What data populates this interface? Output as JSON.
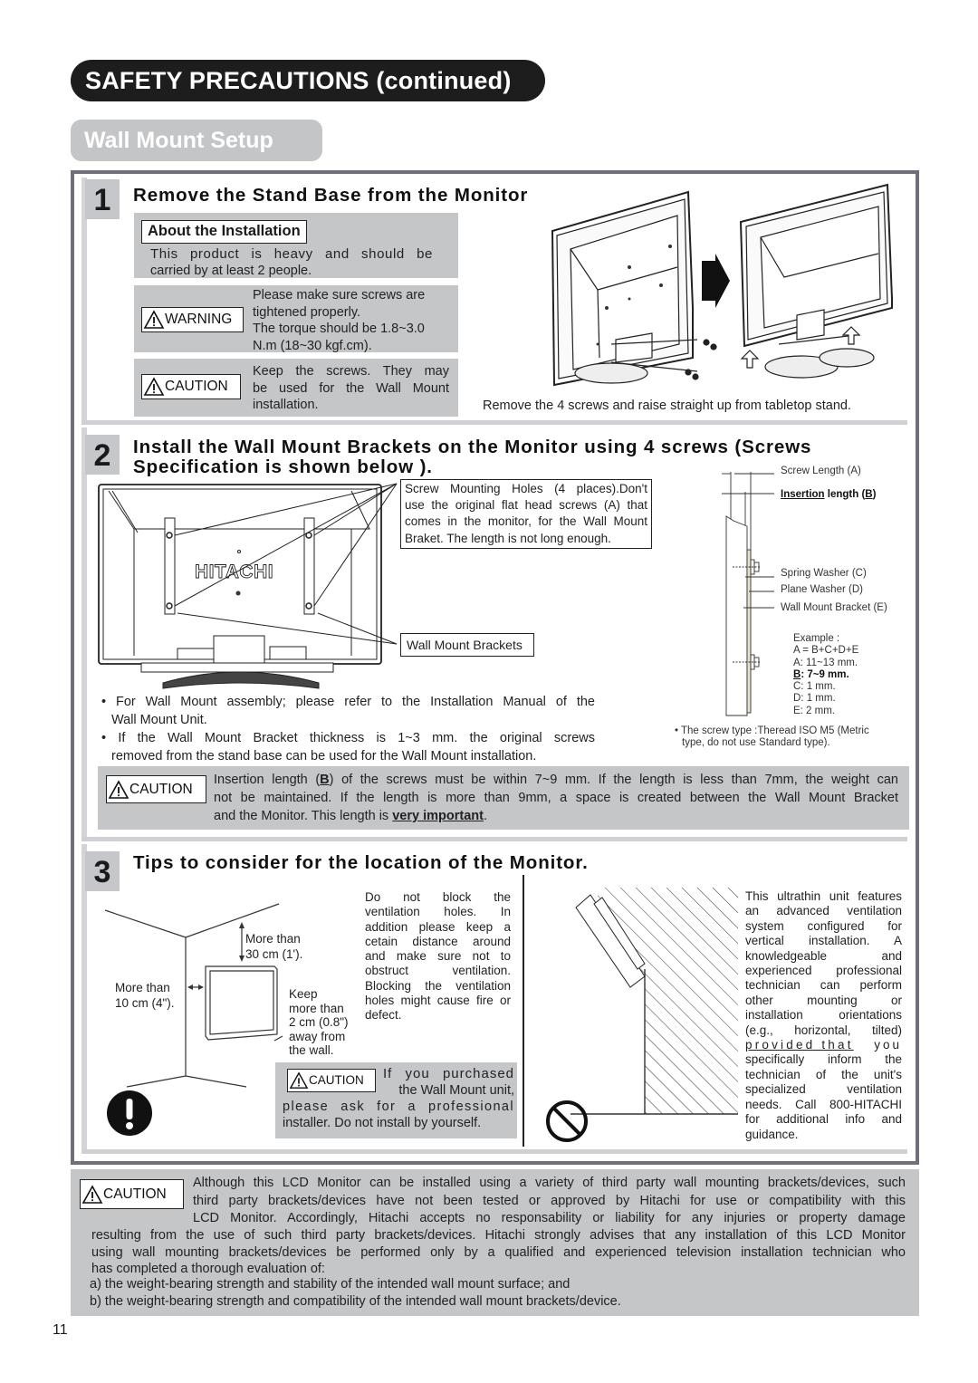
{
  "header": {
    "title": "SAFETY PRECAUTIONS (continued)",
    "subtitle": "Wall Mount Setup"
  },
  "step1": {
    "number": "1",
    "title": "Remove the Stand Base from the Monitor",
    "about_label": "About the Installation",
    "about_text_line1": "This product is heavy and should be",
    "about_text_line2": "carried by at least 2 people.",
    "warning_label": "WARNING",
    "warning_lines": [
      "Please make sure screws are",
      "tightened properly.",
      "The torque should be 1.8~3.0",
      "N.m (18~30 kgf.cm)."
    ],
    "caution_label": "CAUTION",
    "caution_lines": [
      "Keep the screws. They may",
      "be used for the Wall Mount",
      "installation."
    ],
    "figure_caption": "Remove the 4 screws and raise straight up from tabletop stand."
  },
  "step2": {
    "number": "2",
    "title_line1": "Install the Wall Mount Brackets on the Monitor using 4 screws (Screws",
    "title_line2": "Specification is shown below ).",
    "callout_holes_lines": [
      "Screw Mounting Holes (4 places).Don't",
      "use the original flat head screws (A) that",
      "comes in the monitor, for the Wall Mount",
      "Braket. The length is not long enough."
    ],
    "callout_brackets": "Wall Mount Brackets",
    "brand_logo": "HITACHI",
    "bullets": [
      {
        "line1": "For Wall Mount assembly; please refer to the Installation Manual of the",
        "line2": "Wall Mount Unit."
      },
      {
        "line1": "If the Wall Mount Bracket thickness is 1~3 mm. the original screws",
        "line2": "removed from the stand base can be used for the Wall Mount installation."
      }
    ],
    "diagram": {
      "screw_length": "Screw Length (A)",
      "insertion_prefix": "Insertion",
      "insertion_mid": " length (",
      "insertion_b": "B",
      "insertion_end": ")",
      "spring_washer": "Spring Washer (C)",
      "plane_washer": "Plane Washer (D)",
      "bracket": "Wall Mount Bracket (E)",
      "example_lines": [
        "Example :",
        "A = B+C+D+E",
        "A: 11~13 mm."
      ],
      "example_b_letter": "B",
      "example_b_rest": ": 7~9 mm.",
      "example_lines2": [
        "C: 1 mm.",
        "D: 1 mm.",
        "E: 2 mm."
      ],
      "screw_type_line1": "The screw type :Theread ISO M5 (Metric",
      "screw_type_line2": "type, do not use Standard type)."
    },
    "caution_label": "CAUTION",
    "caution_line1_a": "Insertion length (",
    "caution_line1_b": "B",
    "caution_line1_c": ") of the screws must be within 7~9 mm. If the length is less than 7mm, the weight can",
    "caution_line2": "not be maintained. If the length is more than 9mm, a space is created between the Wall Mount Bracket",
    "caution_line3_a": "and the Monitor. This length is ",
    "caution_line3_b": "very important",
    "caution_line3_c": "."
  },
  "step3": {
    "number": "3",
    "title": "Tips to consider for the location of the Monitor.",
    "label_top_1": "More than",
    "label_top_2": "30 cm (1').",
    "label_left_1": "More than",
    "label_left_2": "10 cm (4\").",
    "label_wall_lines": [
      "Keep",
      "more than",
      "2 cm (0.8\")",
      "away from",
      "the wall."
    ],
    "ventilation_lines": [
      "Do not block the",
      "ventilation holes. In",
      "addition please keep a",
      "cetain distance around",
      "and make sure not to",
      "obstruct ventilation.",
      "Blocking the ventilation",
      "holes might cause fire or",
      "defect."
    ],
    "caution_label": "CAUTION",
    "caution_lines": [
      "If you purchased",
      "the Wall Mount unit,",
      "please ask for a professional",
      "installer. Do not install by yourself."
    ],
    "ultrathin_lines": [
      "This ultrathin unit features",
      "an advanced ventilation",
      "system configured for",
      "vertical installation. A",
      "knowledgeable and",
      "experienced professional",
      "technician can perform",
      "other mounting or",
      "installation orientations",
      "(e.g., horizontal, tilted)"
    ],
    "provided_that": "provided that",
    "provided_rest": " you",
    "ultrathin_lines2": [
      "specifically inform the",
      "technician of the unit's",
      "specialized ventilation",
      "needs. Call 800-HITACHI",
      "for additional info and",
      "guidance."
    ]
  },
  "footer_caution": {
    "label": "CAUTION",
    "lines_indented": [
      "Although this LCD Monitor can be installed using a variety of third party wall mounting brackets/devices, such",
      "third party brackets/devices have not been tested or approved by Hitachi for use or compatibility with this",
      "LCD Monitor. Accordingly, Hitachi accepts no responsability or liability for any injuries or property damage"
    ],
    "lines_full": [
      "resulting from the use of such third party brackets/devices. Hitachi strongly advises that any installation of this LCD Monitor",
      "using wall mounting brackets/devices be performed only by a qualified and experienced television installation technician who",
      "has completed a thorough evaluation of:"
    ],
    "items": [
      "a) the weight-bearing strength and stability of the intended wall mount surface; and",
      "b) the weight-bearing strength and compatibility of the intended wall mount brackets/device."
    ]
  },
  "page_number": "11"
}
